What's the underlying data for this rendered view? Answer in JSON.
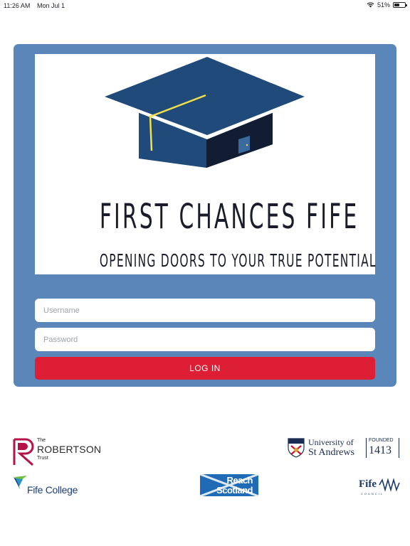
{
  "status": {
    "time": "11:26 AM",
    "date": "Mon Jul 1",
    "battery": "51%",
    "battery_level": 0.51
  },
  "brand": {
    "title": "FIRST CHANCES FIFE",
    "tagline": "OPENING DOORS TO YOUR TRUE POTENTIAL"
  },
  "login": {
    "username_placeholder": "Username",
    "password_placeholder": "Password",
    "button_label": "LOG IN"
  },
  "partners": {
    "robertson": {
      "the": "The",
      "name": "ROBERTSON",
      "trust": "Trust"
    },
    "st_andrews": {
      "line1": "University of",
      "line2": "St Andrews",
      "founded": "FOUNDED",
      "year": "1413"
    },
    "fife_college": {
      "name": "Fife College"
    },
    "reach_scotland": {
      "line1": "Reach",
      "line2": "Scotland"
    },
    "fife_council": {
      "name": "Fife",
      "sub": "COUNCIL"
    }
  },
  "colors": {
    "card": "#5b86b9",
    "button": "#dd1e34",
    "cap_navy": "#1f4a7a",
    "tassel": "#f2e04a"
  }
}
